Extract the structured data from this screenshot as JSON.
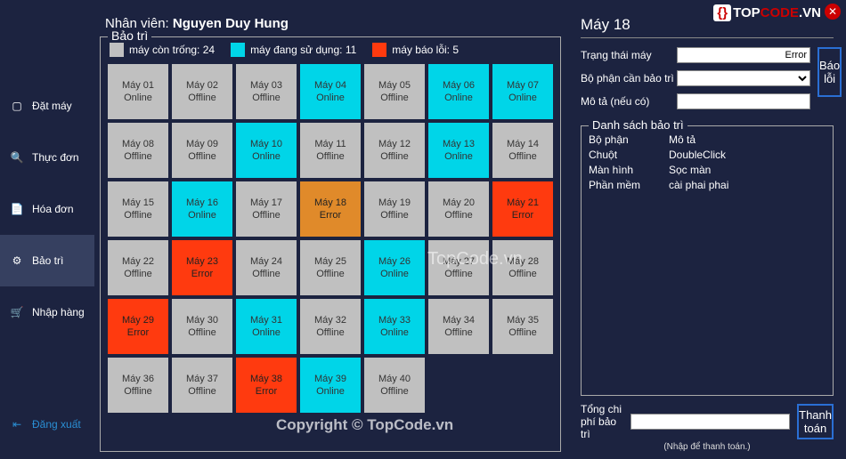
{
  "watermark": {
    "logo_prefix": "{}",
    "logo_t1": "TOP",
    "logo_t2": "CODE",
    "logo_suffix": ".VN",
    "center": "TopCode.vn",
    "bottom": "Copyright © TopCode.vn"
  },
  "staff": {
    "label": "Nhân viên:",
    "name": "Nguyen Duy Hung"
  },
  "nav": {
    "items": [
      {
        "label": "Đặt máy",
        "icon": "monitor-icon"
      },
      {
        "label": "Thực đơn",
        "icon": "search-icon"
      },
      {
        "label": "Hóa đơn",
        "icon": "invoice-icon"
      },
      {
        "label": "Bảo trì",
        "icon": "gear-icon",
        "active": true
      },
      {
        "label": "Nhập hàng",
        "icon": "cart-icon"
      }
    ],
    "logout": {
      "label": "Đăng xuất",
      "icon": "logout-icon"
    }
  },
  "maintenance": {
    "title": "Bảo trì",
    "legend": {
      "free": "máy còn trống: 24",
      "busy": "máy đang sử dụng: 11",
      "error": "máy báo lỗi:  5"
    },
    "machines": [
      {
        "n": "Máy 01",
        "s": "Online",
        "c": "gray"
      },
      {
        "n": "Máy 02",
        "s": "Offline",
        "c": "gray"
      },
      {
        "n": "Máy 03",
        "s": "Offline",
        "c": "gray"
      },
      {
        "n": "Máy 04",
        "s": "Online",
        "c": "cyan"
      },
      {
        "n": "Máy 05",
        "s": "Offline",
        "c": "gray"
      },
      {
        "n": "Máy 06",
        "s": "Online",
        "c": "cyan"
      },
      {
        "n": "Máy 07",
        "s": "Online",
        "c": "cyan"
      },
      {
        "n": "Máy 08",
        "s": "Offline",
        "c": "gray"
      },
      {
        "n": "Máy 09",
        "s": "Offline",
        "c": "gray"
      },
      {
        "n": "Máy 10",
        "s": "Online",
        "c": "cyan"
      },
      {
        "n": "Máy 11",
        "s": "Offline",
        "c": "gray"
      },
      {
        "n": "Máy 12",
        "s": "Offline",
        "c": "gray"
      },
      {
        "n": "Máy 13",
        "s": "Online",
        "c": "cyan"
      },
      {
        "n": "Máy 14",
        "s": "Offline",
        "c": "gray"
      },
      {
        "n": "Máy 15",
        "s": "Offline",
        "c": "gray"
      },
      {
        "n": "Máy 16",
        "s": "Online",
        "c": "cyan"
      },
      {
        "n": "Máy 17",
        "s": "Offline",
        "c": "gray"
      },
      {
        "n": "Máy 18",
        "s": "Error",
        "c": "orange"
      },
      {
        "n": "Máy 19",
        "s": "Offline",
        "c": "gray"
      },
      {
        "n": "Máy 20",
        "s": "Offline",
        "c": "gray"
      },
      {
        "n": "Máy 21",
        "s": "Error",
        "c": "red"
      },
      {
        "n": "Máy 22",
        "s": "Offline",
        "c": "gray"
      },
      {
        "n": "Máy 23",
        "s": "Error",
        "c": "red"
      },
      {
        "n": "Máy 24",
        "s": "Offline",
        "c": "gray"
      },
      {
        "n": "Máy 25",
        "s": "Offline",
        "c": "gray"
      },
      {
        "n": "Máy 26",
        "s": "Online",
        "c": "cyan"
      },
      {
        "n": "Máy 27",
        "s": "Offline",
        "c": "gray"
      },
      {
        "n": "Máy 28",
        "s": "Offline",
        "c": "gray"
      },
      {
        "n": "Máy 29",
        "s": "Error",
        "c": "red"
      },
      {
        "n": "Máy 30",
        "s": "Offline",
        "c": "gray"
      },
      {
        "n": "Máy 31",
        "s": "Online",
        "c": "cyan"
      },
      {
        "n": "Máy 32",
        "s": "Offline",
        "c": "gray"
      },
      {
        "n": "Máy 33",
        "s": "Online",
        "c": "cyan"
      },
      {
        "n": "Máy 34",
        "s": "Offline",
        "c": "gray"
      },
      {
        "n": "Máy 35",
        "s": "Offline",
        "c": "gray"
      },
      {
        "n": "Máy 36",
        "s": "Offline",
        "c": "gray"
      },
      {
        "n": "Máy 37",
        "s": "Offline",
        "c": "gray"
      },
      {
        "n": "Máy 38",
        "s": "Error",
        "c": "red"
      },
      {
        "n": "Máy 39",
        "s": "Online",
        "c": "cyan"
      },
      {
        "n": "Máy 40",
        "s": "Offline",
        "c": "gray"
      }
    ]
  },
  "detail": {
    "title": "Máy 18",
    "status_label": "Trạng thái máy",
    "status_value": "Error",
    "part_label": "Bộ phận cần bảo trì",
    "desc_label": "Mô tả (nếu có)",
    "report_btn": "Báo lỗi",
    "list_title": "Danh sách bảo trì",
    "list_header": {
      "c1": "Bộ phận",
      "c2": "Mô tả"
    },
    "list_rows": [
      {
        "c1": "Chuột",
        "c2": "DoubleClick"
      },
      {
        "c1": "Màn hình",
        "c2": "Sọc màn"
      },
      {
        "c1": "Phần mềm",
        "c2": "cài phai phai"
      }
    ],
    "total_label": "Tổng chi phí bảo trì",
    "hint": "(Nhập để thanh toán.)",
    "pay_btn": "Thanh toán"
  }
}
